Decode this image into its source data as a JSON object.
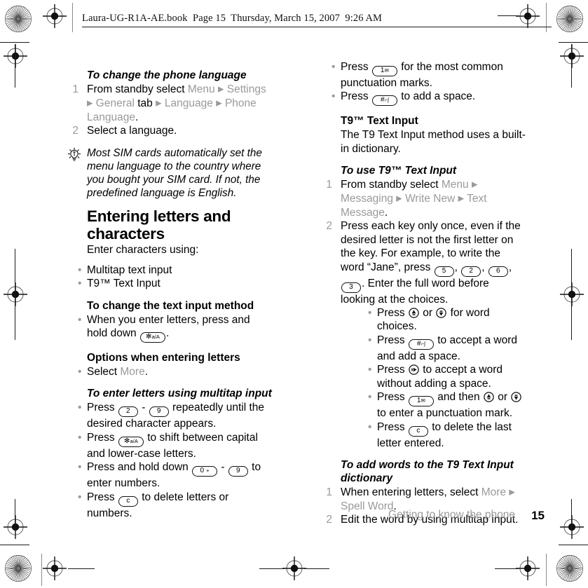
{
  "header": {
    "slug": "Laura-UG-R1A-AE.book  Page 15  Thursday, March 15, 2007  9:26 AM"
  },
  "colors": {
    "ui_term": "#9a9a9a",
    "body_text": "#000000",
    "page_background": "#ffffff"
  },
  "left_column": {
    "proc_language": {
      "heading": "To change the phone language",
      "steps": [
        {
          "num": "1",
          "pre": "From standby select ",
          "path": [
            "Menu",
            "Settings",
            "General",
            "Language",
            "Phone Language"
          ],
          "tab_word": "tab",
          "period": "."
        },
        {
          "num": "2",
          "text": "Select a language."
        }
      ]
    },
    "tip": {
      "icon": "lightbulb-icon",
      "text": "Most SIM cards automatically set the menu language to the country where you bought your SIM card. If not, the predefined language is English."
    },
    "section_entering": {
      "heading": "Entering letters and characters",
      "intro": "Enter characters using:",
      "methods": [
        "Multitap text input",
        "T9™ Text Input"
      ]
    },
    "proc_change_method": {
      "heading": "To change the text input method",
      "bullet_pre": "When you enter letters, press and hold down ",
      "key": {
        "name": "star-key",
        "main": "✻",
        "sub": "a/A"
      },
      "bullet_post": "."
    },
    "options_entering": {
      "heading": "Options when entering letters",
      "bullet_pre": "Select ",
      "ui": "More",
      "bullet_post": "."
    },
    "proc_multitap": {
      "heading": "To enter letters using multitap input",
      "bullets": [
        {
          "pre": "Press ",
          "key1": {
            "name": "key-2",
            "main": "2",
            "sub": ""
          },
          "mid": " - ",
          "key2": {
            "name": "key-9",
            "main": "9",
            "sub": ""
          },
          "post": " repeatedly until the desired character appears."
        },
        {
          "pre": "Press ",
          "key1": {
            "name": "star-key",
            "main": "✻",
            "sub": "a/A"
          },
          "mid": "",
          "key2": null,
          "post": " to shift between capital and lower-case letters."
        },
        {
          "pre": "Press and hold down ",
          "key1": {
            "name": "key-0",
            "main": "0",
            "sub": "+"
          },
          "mid": " - ",
          "key2": {
            "name": "key-9",
            "main": "9",
            "sub": ""
          },
          "post": " to enter numbers."
        },
        {
          "pre": "Press ",
          "key1": {
            "name": "clear-key",
            "main": "c",
            "sub": ""
          },
          "mid": "",
          "key2": null,
          "post": " to delete letters or numbers."
        }
      ]
    }
  },
  "right_column": {
    "continued_bullets": [
      {
        "pre": "Press ",
        "key": {
          "name": "key-1-voicemail",
          "main": "1",
          "sub": "✉"
        },
        "post": " for the most common punctuation marks."
      },
      {
        "pre": "Press ",
        "key": {
          "name": "hash-key",
          "main": "#",
          "sub": "⌐ʃ"
        },
        "post": " to add a space."
      }
    ],
    "t9_section": {
      "heading": "T9™ Text Input",
      "body": "The T9 Text Input method uses a built-in dictionary."
    },
    "proc_use_t9": {
      "heading": "To use T9™ Text Input",
      "step1": {
        "num": "1",
        "pre": "From standby select ",
        "path": [
          "Menu",
          "Messaging",
          "Write New",
          "Text Message"
        ],
        "period": "."
      },
      "step2": {
        "num": "2",
        "pre": "Press each key only once, even if the desired letter is not the first letter on the key. For example, to write the word “Jane”, press ",
        "keys": [
          {
            "name": "key-5",
            "main": "5",
            "sub": ""
          },
          {
            "name": "key-2",
            "main": "2",
            "sub": ""
          },
          {
            "name": "key-6",
            "main": "6",
            "sub": ""
          },
          {
            "name": "key-3",
            "main": "3",
            "sub": ""
          }
        ],
        "post": ". Enter the full word before looking at the choices."
      },
      "sub_bullets": [
        {
          "pre": "Press ",
          "keys": [
            {
              "name": "nav-up-key",
              "shape": "round",
              "dir": "up"
            },
            {
              "name": "nav-down-key",
              "shape": "round",
              "dir": "down"
            }
          ],
          "joiner": " or ",
          "post": " for word choices."
        },
        {
          "pre": "Press ",
          "keys": [
            {
              "name": "hash-key",
              "shape": "pill",
              "main": "#",
              "sub": "⌐ʃ"
            }
          ],
          "joiner": "",
          "post": " to accept a word and add a space."
        },
        {
          "pre": "Press ",
          "keys": [
            {
              "name": "nav-right-key",
              "shape": "round",
              "dir": "right"
            }
          ],
          "joiner": "",
          "post": " to accept a word without adding a space."
        },
        {
          "pre": "Press ",
          "keys": [
            {
              "name": "key-1-voicemail",
              "shape": "pill",
              "main": "1",
              "sub": "✉"
            },
            {
              "name": "nav-up-key",
              "shape": "round",
              "dir": "up"
            },
            {
              "name": "nav-down-key",
              "shape": "round",
              "dir": "down"
            }
          ],
          "joiner": " and then ",
          "joiner2": " or ",
          "post": " to enter a punctuation mark."
        },
        {
          "pre": "Press ",
          "keys": [
            {
              "name": "clear-key",
              "shape": "pill",
              "main": "c",
              "sub": ""
            }
          ],
          "joiner": "",
          "post": " to delete the last letter entered."
        }
      ]
    },
    "proc_add_words": {
      "heading": "To add words to the T9 Text Input dictionary",
      "step1": {
        "num": "1",
        "pre": "When entering letters, select ",
        "path": [
          "More",
          "Spell Word"
        ],
        "period": "."
      },
      "step2": {
        "num": "2",
        "text": "Edit the word by using multitap input."
      }
    }
  },
  "footer": {
    "section_title": "Getting to know the phone",
    "page_number": "15"
  }
}
